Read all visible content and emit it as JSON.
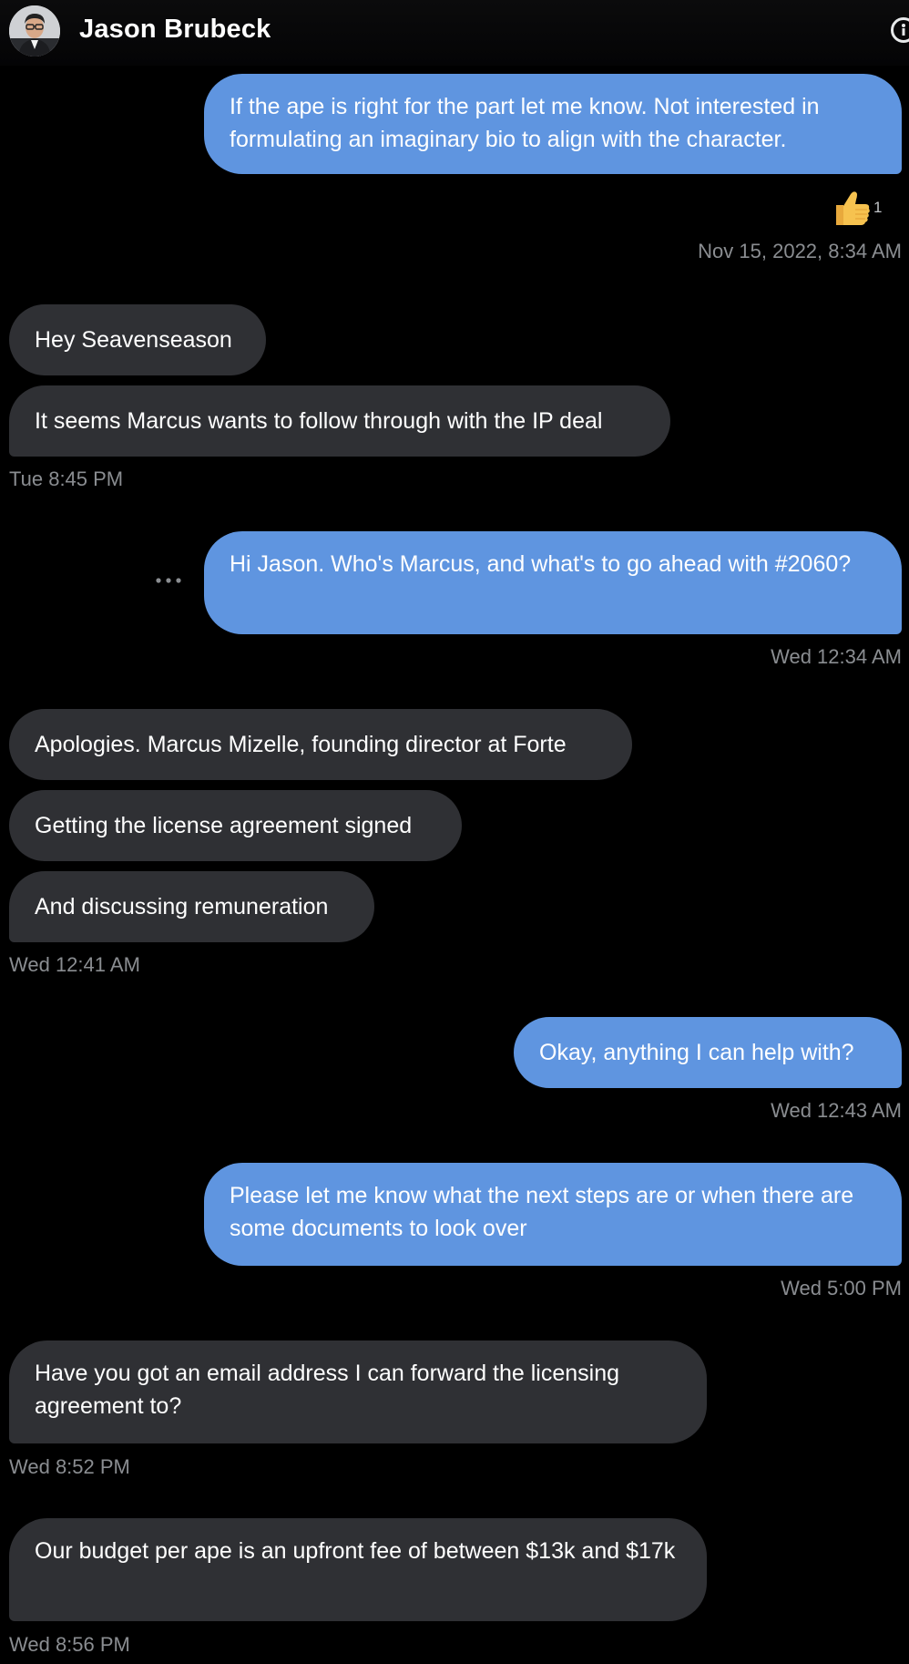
{
  "header": {
    "contact_name": "Jason Brubeck",
    "avatar_icon": "user-avatar",
    "info_icon": "info-icon"
  },
  "messages": [
    {
      "direction": "sent",
      "text": "If the ape is right for the part let me know. Not interested in formulating an imaginary bio to align with the character.",
      "reaction": {
        "icon": "thumbs-up-icon",
        "count": "1"
      },
      "timestamp": "Nov 15, 2022, 8:34 AM"
    },
    {
      "direction": "received",
      "text": "Hey Seavenseason"
    },
    {
      "direction": "received",
      "text": "It seems Marcus wants to follow through with the IP deal",
      "timestamp": "Tue 8:45 PM"
    },
    {
      "direction": "sent",
      "text": "Hi Jason. Who's Marcus, and what's to go ahead with #2060?",
      "timestamp": "Wed 12:34 AM"
    },
    {
      "direction": "received",
      "text": "Apologies. Marcus Mizelle, founding director at Forte"
    },
    {
      "direction": "received",
      "text": "Getting the license agreement signed"
    },
    {
      "direction": "received",
      "text": "And discussing remuneration",
      "timestamp": "Wed 12:41 AM"
    },
    {
      "direction": "sent",
      "text": "Okay, anything I can help with?",
      "timestamp": "Wed 12:43 AM"
    },
    {
      "direction": "sent",
      "text": "Please let me know what the next steps are or when there are some documents to look over",
      "timestamp": "Wed 5:00 PM"
    },
    {
      "direction": "received",
      "text": "Have you got an email address I can forward the licensing agreement to?",
      "timestamp": "Wed 8:52 PM"
    },
    {
      "direction": "received",
      "text": "Our budget per ape is an upfront fee of between $13k and $17k",
      "timestamp": "Wed 8:56 PM"
    }
  ],
  "colors": {
    "background": "#000000",
    "sent_bubble": "#5f95e0",
    "received_bubble": "#2f3034",
    "timestamp": "#8a8d91"
  }
}
